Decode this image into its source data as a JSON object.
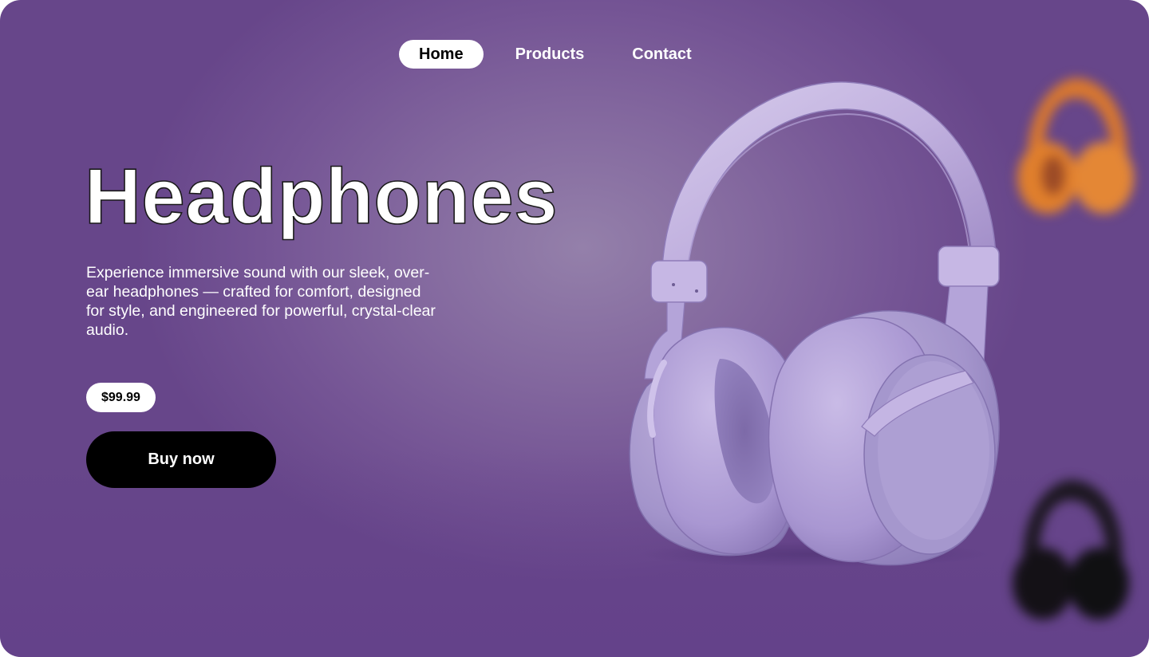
{
  "nav": {
    "items": [
      {
        "label": "Home",
        "active": true
      },
      {
        "label": "Products",
        "active": false
      },
      {
        "label": "Contact",
        "active": false
      }
    ]
  },
  "hero": {
    "title": "Headphones",
    "description": "Experience immersive sound with our sleek, over-ear headphones — crafted for comfort, designed for style, and engineered for powerful, crystal-clear audio.",
    "price": "$99.99",
    "cta_label": "Buy now"
  },
  "product": {
    "image": "headphones-lavender-image",
    "color": "#c3b3e0"
  },
  "variants": [
    {
      "name": "headphones-orange-thumbnail",
      "color": "#e0792a"
    },
    {
      "name": "headphones-black-thumbnail",
      "color": "#151515"
    }
  ],
  "theme": {
    "background": "#7f62a0",
    "accent_dark": "#000000",
    "pill": "#ffffff"
  }
}
